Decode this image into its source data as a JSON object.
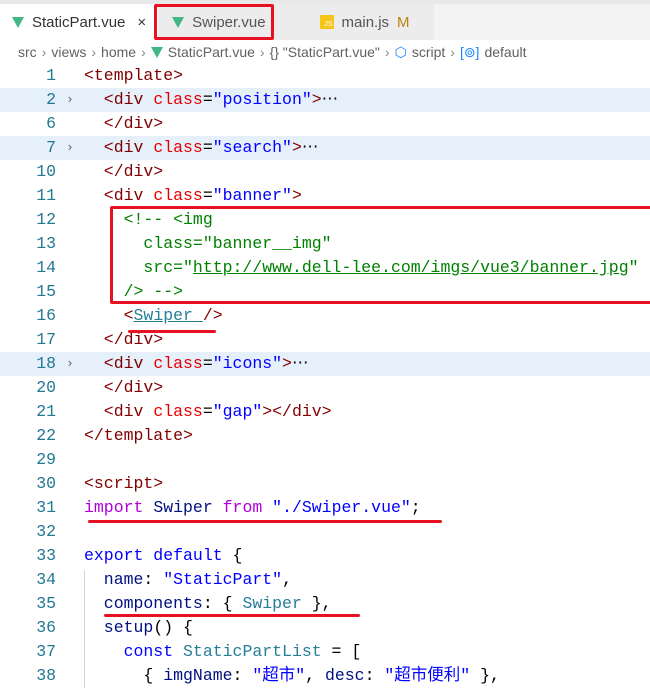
{
  "tabs": [
    {
      "label": "StaticPart.vue",
      "icon": "vue-icon",
      "close": "×",
      "active": true
    },
    {
      "label": "Swiper.vue",
      "icon": "vue-icon",
      "active": false
    },
    {
      "label": "main.js",
      "icon": "js-icon",
      "badge": "M",
      "active": false
    }
  ],
  "breadcrumb": [
    "src",
    "views",
    "home",
    "StaticPart.vue",
    "{} \"StaticPart.vue\"",
    "script",
    "default"
  ],
  "lines": [
    {
      "n": "1",
      "t": [
        [
          "<template>",
          "tag"
        ]
      ]
    },
    {
      "n": "2",
      "fold": true,
      "t": [
        [
          "  <div ",
          "tag"
        ],
        [
          "class",
          "attr"
        ],
        [
          "=",
          "txt"
        ],
        [
          "\"position\"",
          "str"
        ],
        [
          ">",
          "tag"
        ],
        [
          "⋯",
          "txt"
        ]
      ]
    },
    {
      "n": "6",
      "t": [
        [
          "  </div>",
          "tag"
        ]
      ]
    },
    {
      "n": "7",
      "fold": true,
      "t": [
        [
          "  <div ",
          "tag"
        ],
        [
          "class",
          "attr"
        ],
        [
          "=",
          "txt"
        ],
        [
          "\"search\"",
          "str"
        ],
        [
          ">",
          "tag"
        ],
        [
          "⋯",
          "txt"
        ]
      ]
    },
    {
      "n": "10",
      "t": [
        [
          "  </div>",
          "tag"
        ]
      ]
    },
    {
      "n": "11",
      "t": [
        [
          "  <div ",
          "tag"
        ],
        [
          "class",
          "attr"
        ],
        [
          "=",
          "txt"
        ],
        [
          "\"banner\"",
          "str"
        ],
        [
          ">",
          "tag"
        ]
      ]
    },
    {
      "n": "12",
      "t": [
        [
          "    <!-- <img",
          "com"
        ]
      ]
    },
    {
      "n": "13",
      "t": [
        [
          "      class=\"banner__img\"",
          "com"
        ]
      ]
    },
    {
      "n": "14",
      "t": [
        [
          "      src=\"",
          "com"
        ],
        [
          "http://www.dell-lee.com/imgs/vue3/banner.jpg",
          "url"
        ],
        [
          "\"",
          "com"
        ]
      ]
    },
    {
      "n": "15",
      "t": [
        [
          "    /> -->",
          "com"
        ]
      ]
    },
    {
      "n": "16",
      "t": [
        [
          "    <",
          "tag"
        ],
        [
          "Swiper ",
          "cmp"
        ],
        [
          "/>",
          "tag"
        ]
      ]
    },
    {
      "n": "17",
      "t": [
        [
          "  </div>",
          "tag"
        ]
      ]
    },
    {
      "n": "18",
      "fold": true,
      "t": [
        [
          "  <div ",
          "tag"
        ],
        [
          "class",
          "attr"
        ],
        [
          "=",
          "txt"
        ],
        [
          "\"icons\"",
          "str"
        ],
        [
          ">",
          "tag"
        ],
        [
          "⋯",
          "txt"
        ]
      ]
    },
    {
      "n": "20",
      "t": [
        [
          "  </div>",
          "tag"
        ]
      ]
    },
    {
      "n": "21",
      "t": [
        [
          "  <div ",
          "tag"
        ],
        [
          "class",
          "attr"
        ],
        [
          "=",
          "txt"
        ],
        [
          "\"gap\"",
          "str"
        ],
        [
          "></div>",
          "tag"
        ]
      ]
    },
    {
      "n": "22",
      "t": [
        [
          "</template>",
          "tag"
        ]
      ]
    },
    {
      "n": "29",
      "t": []
    },
    {
      "n": "30",
      "t": [
        [
          "<script>",
          "tag"
        ]
      ]
    },
    {
      "n": "31",
      "t": [
        [
          "import",
          "kw"
        ],
        [
          " Swiper ",
          "prop"
        ],
        [
          "from",
          "kw"
        ],
        [
          " ",
          "txt"
        ],
        [
          "\"./Swiper.vue\"",
          "str"
        ],
        [
          ";",
          "txt"
        ]
      ]
    },
    {
      "n": "32",
      "t": []
    },
    {
      "n": "33",
      "t": [
        [
          "export default",
          "kw2"
        ],
        [
          " {",
          "txt"
        ]
      ]
    },
    {
      "n": "34",
      "t": [
        [
          "  name",
          "prop"
        ],
        [
          ": ",
          "txt"
        ],
        [
          "\"StaticPart\"",
          "str"
        ],
        [
          ",",
          "txt"
        ]
      ]
    },
    {
      "n": "35",
      "t": [
        [
          "  components",
          "prop"
        ],
        [
          ": { ",
          "txt"
        ],
        [
          "Swiper",
          "cls"
        ],
        [
          " },",
          "txt"
        ]
      ]
    },
    {
      "n": "36",
      "t": [
        [
          "  setup",
          "prop"
        ],
        [
          "() {",
          "txt"
        ]
      ]
    },
    {
      "n": "37",
      "t": [
        [
          "    const ",
          "kw2"
        ],
        [
          "StaticPartList",
          "cls"
        ],
        [
          " = [",
          "txt"
        ]
      ]
    },
    {
      "n": "38",
      "t": [
        [
          "      { ",
          "txt"
        ],
        [
          "imgName",
          "prop"
        ],
        [
          ": ",
          "txt"
        ],
        [
          "\"超市\"",
          "str"
        ],
        [
          ", ",
          "txt"
        ],
        [
          "desc",
          "prop"
        ],
        [
          ": ",
          "txt"
        ],
        [
          "\"超市便利\"",
          "str"
        ],
        [
          " },",
          "txt"
        ]
      ]
    }
  ]
}
